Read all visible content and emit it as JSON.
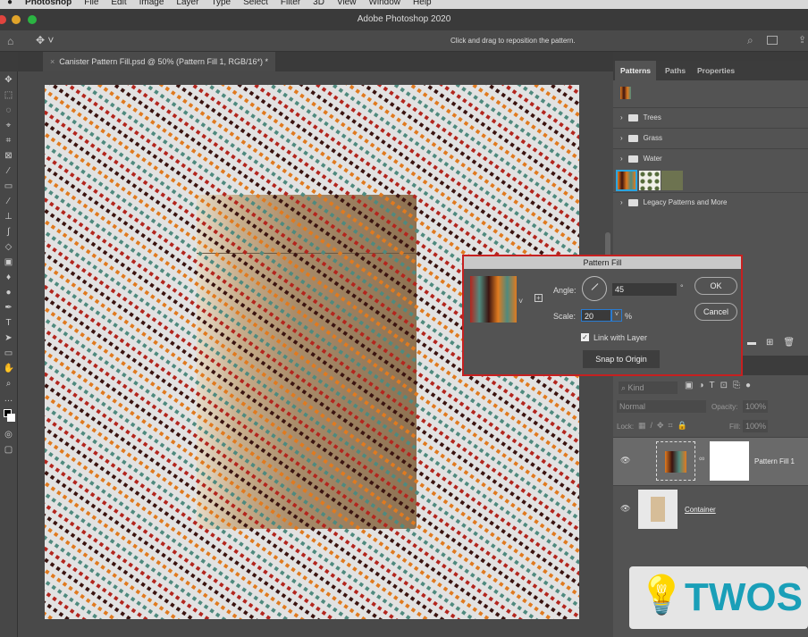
{
  "menubar": {
    "items": [
      "Photoshop",
      "File",
      "Edit",
      "Image",
      "Layer",
      "Type",
      "Select",
      "Filter",
      "3D",
      "View",
      "Window",
      "Help"
    ]
  },
  "window": {
    "title": "Adobe Photoshop 2020"
  },
  "options": {
    "hint": "Click and drag to reposition the pattern."
  },
  "document": {
    "tab": "Canister Pattern Fill.psd @ 50% (Pattern Fill 1, RGB/16*) *",
    "pattern_colors": [
      "#e07a1f",
      "#4f8a7e",
      "#b3261e",
      "#3b1410"
    ]
  },
  "panel": {
    "tabs": [
      "Patterns",
      "Paths",
      "Properties"
    ],
    "groups": [
      "Trees",
      "Grass",
      "Water",
      "Legacy Patterns and More"
    ]
  },
  "dialog": {
    "title": "Pattern Fill",
    "angle_label": "Angle:",
    "angle": "45",
    "degree": "°",
    "scale_label": "Scale:",
    "scale": "20",
    "percent": "%",
    "link_label": "Link with Layer",
    "link_checked": true,
    "snap": "Snap to Origin",
    "ok": "OK",
    "cancel": "Cancel"
  },
  "layers": {
    "kind": "Kind",
    "blend": "Normal",
    "opacity_label": "Opacity:",
    "opacity": "100%",
    "lock_label": "Lock:",
    "fill_label": "Fill:",
    "fill": "100%",
    "items": [
      {
        "name": "Pattern Fill 1"
      },
      {
        "name": "Container"
      }
    ]
  },
  "watermark": {
    "text": "TWOS"
  }
}
